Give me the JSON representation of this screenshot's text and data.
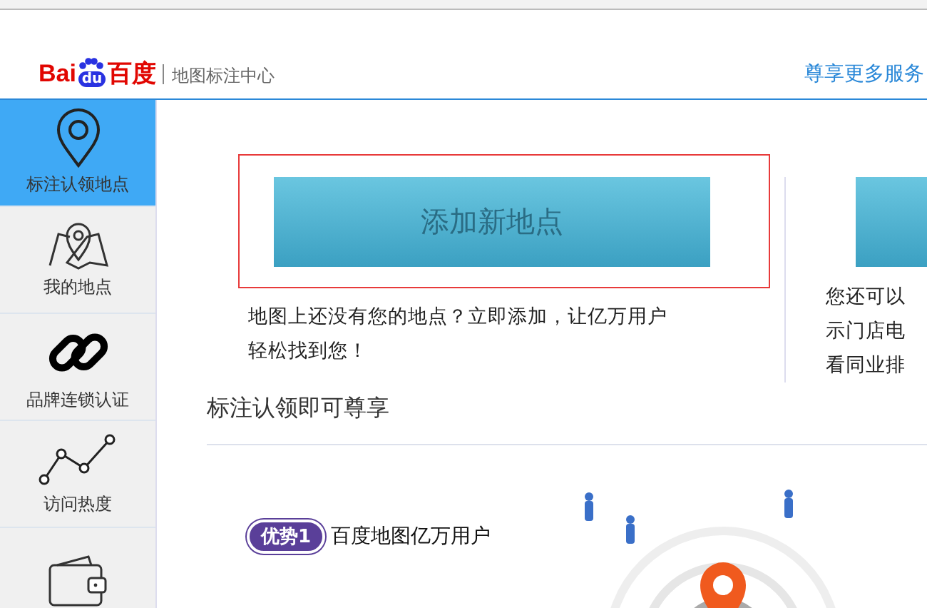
{
  "header": {
    "logo_latin": "Bai",
    "logo_paw": "du",
    "logo_cn": "百度",
    "subtitle": "地图标注中心",
    "link": "尊享更多服务"
  },
  "sidebar": [
    {
      "label": "标注认领地点",
      "kind": "pin",
      "selected": true
    },
    {
      "label": "我的地点",
      "kind": "map",
      "selected": false
    },
    {
      "label": "品牌连锁认证",
      "kind": "link",
      "selected": false
    },
    {
      "label": "访问热度",
      "kind": "trend",
      "selected": false
    },
    {
      "kind": "wallet",
      "selected": false
    }
  ],
  "cards": [
    {
      "button": "添加新地点",
      "highlighted": true,
      "lines": [
        "地图上还没有您的地点？立即添加，让亿万用户",
        "轻松找到您！"
      ]
    },
    {
      "highlighted": false,
      "lines": [
        "您还可以",
        "示门店电",
        "看同业排"
      ]
    }
  ],
  "section": {
    "title": "标注认领即可尊享",
    "badge": "优势1",
    "benefit": "百度地图亿万用户"
  }
}
